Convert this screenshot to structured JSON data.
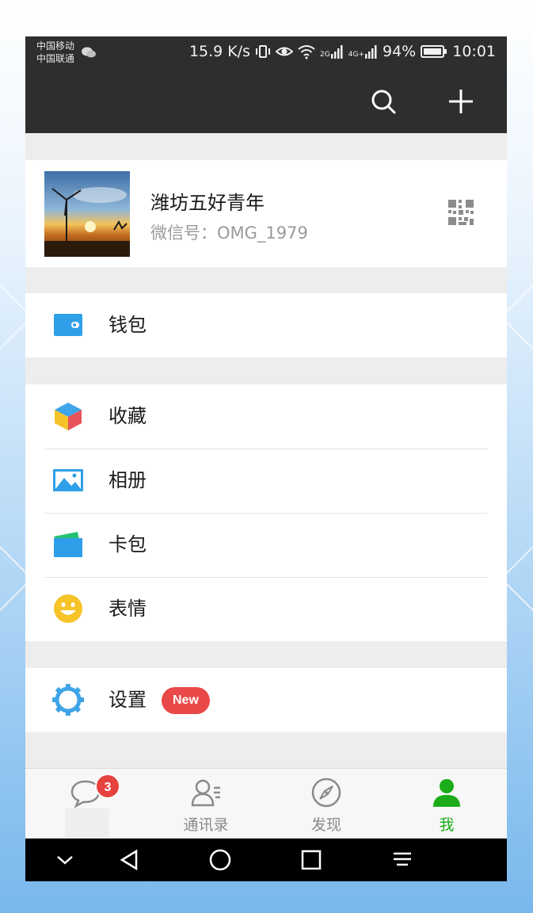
{
  "status_bar": {
    "carrier_1": "中国移动",
    "carrier_2": "中国联通",
    "speed": "15.9 K/s",
    "network_1": "2G",
    "network_2": "4G+",
    "battery": "94%",
    "time": "10:01"
  },
  "title_bar": {
    "search_icon": "search-icon",
    "add_icon": "plus-icon"
  },
  "profile": {
    "nickname": "潍坊五好青年",
    "wechat_id": "微信号：OMG_1979",
    "qr_icon": "qr-code-icon"
  },
  "menu": {
    "wallet": "钱包",
    "favorites": "收藏",
    "album": "相册",
    "cards": "卡包",
    "stickers": "表情",
    "settings": "设置",
    "settings_badge": "New"
  },
  "tabs": [
    {
      "label": "",
      "icon": "chat-icon",
      "badge": "3"
    },
    {
      "label": "通讯录",
      "icon": "contacts-icon"
    },
    {
      "label": "发现",
      "icon": "compass-icon"
    },
    {
      "label": "我",
      "icon": "me-icon",
      "active": true
    }
  ],
  "colors": {
    "header": "#2e2e2e",
    "accent_green": "#1aad19",
    "badge_red": "#e94848",
    "wallet_blue": "#2f9fea"
  }
}
